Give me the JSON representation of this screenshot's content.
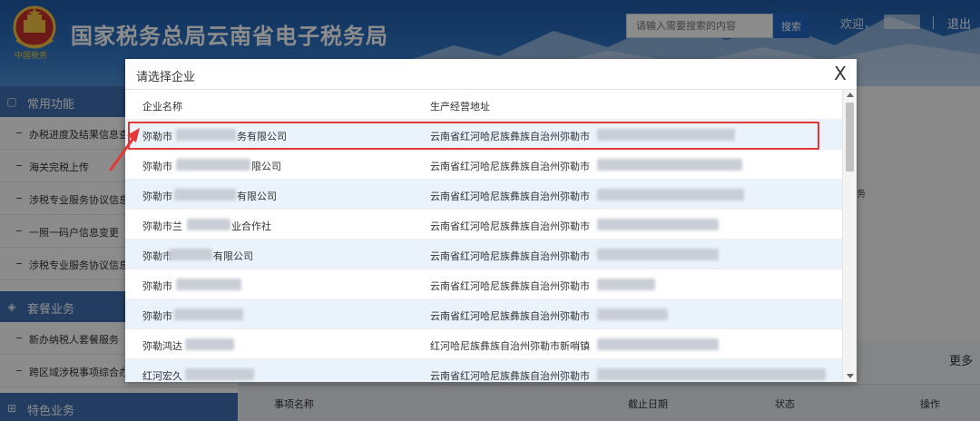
{
  "header": {
    "site_title": "国家税务总局云南省电子税务局",
    "emblem_caption": "中国税务",
    "search_placeholder": "请输入需要搜索的内容",
    "search_button": "搜索",
    "welcome": "欢迎，",
    "logout": "退出"
  },
  "sidebar": {
    "section_common": "常用功能",
    "common_items": [
      "办税进度及结果信息查",
      "海关完税上传",
      "涉税专业服务协议信息",
      "一照一码户信息变更",
      "涉税专业服务协议信息"
    ],
    "section_package": "套餐业务",
    "package_items": [
      "新办纳税人套餐服务",
      "跨区域涉税事项综合办"
    ],
    "section_special": "特色业务"
  },
  "main": {
    "more_link": "更多",
    "table_headers": [
      "事项名称",
      "截止日期",
      "状态",
      "操作"
    ],
    "edge_char": "务"
  },
  "modal": {
    "title": "请选择企业",
    "close": "X",
    "col_company": "企业名称",
    "col_address": "生产经营地址",
    "rows": [
      {
        "name_prefix": "弥勒市",
        "name_suffix": "务有限公司",
        "address": "云南省红河哈尼族彝族自治州弥勒市",
        "selected": true
      },
      {
        "name_prefix": "弥勒市",
        "name_suffix": "限公司",
        "address": "云南省红河哈尼族彝族自治州弥勒市",
        "selected": false
      },
      {
        "name_prefix": "弥勒市",
        "name_suffix": "有限公司",
        "address": "云南省红河哈尼族彝族自治州弥勒市",
        "selected": false
      },
      {
        "name_prefix": "弥勒市兰",
        "name_suffix": "业合作社",
        "address": "云南省红河哈尼族彝族自治州弥勒市",
        "selected": false
      },
      {
        "name_prefix": "弥勒市",
        "name_suffix": "有限公司",
        "address": "云南省红河哈尼族彝族自治州弥勒市",
        "selected": false
      },
      {
        "name_prefix": "弥勒市",
        "name_suffix": "",
        "address": "云南省红河哈尼族彝族自治州弥勒市",
        "selected": false
      },
      {
        "name_prefix": "弥勒市",
        "name_suffix": "",
        "address": "云南省红河哈尼族彝族自治州弥勒市",
        "selected": false
      },
      {
        "name_prefix": "弥勒鸿达",
        "name_suffix": "",
        "address": "红河哈尼族彝族自治州弥勒市新哨镇",
        "selected": false
      },
      {
        "name_prefix": "红河宏久",
        "name_suffix": "",
        "address": "云南省红河哈尼族彝族自治州弥勒市",
        "selected": false
      }
    ]
  },
  "colors": {
    "header_blue": "#2d72c2",
    "section_blue": "#3e6fb1",
    "row_alt": "#eaf2fb",
    "highlight_red": "#e53935"
  }
}
